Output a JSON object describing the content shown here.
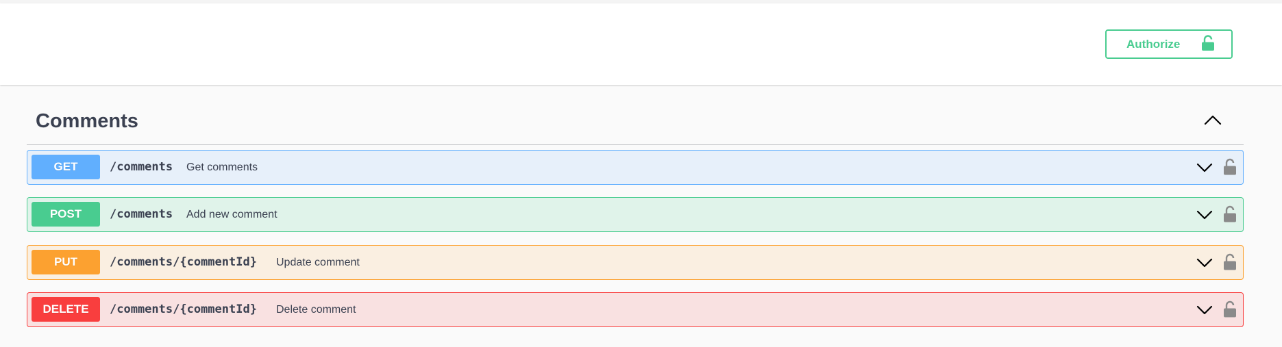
{
  "header": {
    "authorize_label": "Authorize"
  },
  "section": {
    "title": "Comments"
  },
  "operations": [
    {
      "method": "GET",
      "path": "/comments",
      "summary": "Get comments"
    },
    {
      "method": "POST",
      "path": "/comments",
      "summary": "Add new comment"
    },
    {
      "method": "PUT",
      "path": "/comments/{commentId}",
      "summary": "Update comment"
    },
    {
      "method": "DELETE",
      "path": "/comments/{commentId}",
      "summary": "Delete comment"
    }
  ],
  "colors": {
    "get": "#61affe",
    "post": "#49cc90",
    "put": "#fca130",
    "delete": "#f93e3e",
    "authorize": "#49cc90",
    "text": "#3b4151"
  },
  "icons": {
    "authorize": "unlocked-lock-icon",
    "collapse": "chevron-up-icon",
    "expand": "chevron-down-icon",
    "operation_lock": "unlocked-lock-icon"
  }
}
